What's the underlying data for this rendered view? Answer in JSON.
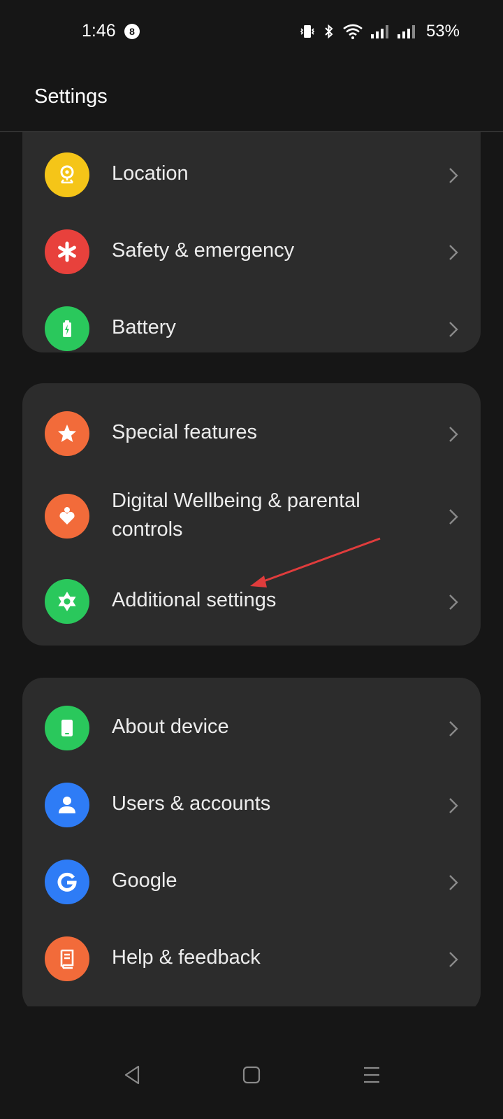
{
  "status": {
    "time": "1:46",
    "notification_count": "8",
    "battery": "53%"
  },
  "header": {
    "title": "Settings"
  },
  "groups": [
    {
      "items": [
        {
          "label": "Location",
          "icon": "location-icon",
          "color": "#f5c518"
        },
        {
          "label": "Safety & emergency",
          "icon": "asterisk-icon",
          "color": "#e8413c"
        },
        {
          "label": "Battery",
          "icon": "battery-icon",
          "color": "#2ac85c"
        }
      ]
    },
    {
      "items": [
        {
          "label": "Special features",
          "icon": "star-icon",
          "color": "#f26b3a"
        },
        {
          "label": "Digital Wellbeing & parental controls",
          "icon": "wellbeing-icon",
          "color": "#f26b3a"
        },
        {
          "label": "Additional settings",
          "icon": "gear-icon",
          "color": "#2ac85c"
        }
      ]
    },
    {
      "items": [
        {
          "label": "About device",
          "icon": "phone-icon",
          "color": "#2ac85c"
        },
        {
          "label": "Users & accounts",
          "icon": "user-icon",
          "color": "#2e7cf6"
        },
        {
          "label": "Google",
          "icon": "google-icon",
          "color": "#2e7cf6"
        },
        {
          "label": "Help & feedback",
          "icon": "help-icon",
          "color": "#f26b3a"
        }
      ]
    }
  ],
  "annotation": {
    "color": "#e03c3c"
  }
}
